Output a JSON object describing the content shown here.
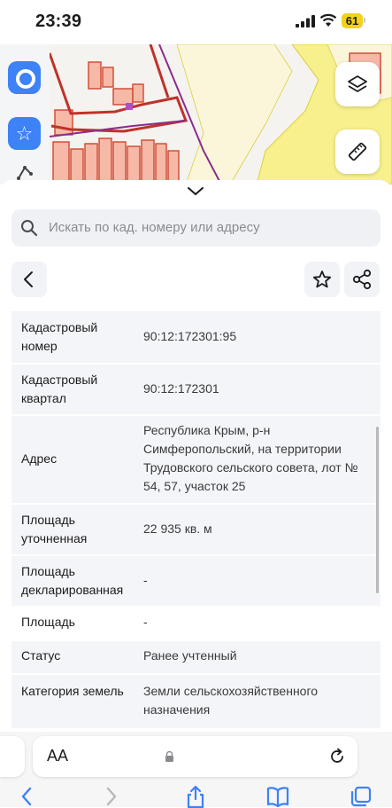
{
  "status_bar": {
    "time": "23:39",
    "battery": "61"
  },
  "sheet": {
    "search_placeholder": "Искать по кад. номеру или адресу",
    "rows": [
      {
        "key": "Кадастровый номер",
        "value": "90:12:172301:95"
      },
      {
        "key": "Кадастровый квартал",
        "value": "90:12:172301"
      },
      {
        "key": "Адрес",
        "value": "Республика Крым, р-н Симферопольский, на территории Трудовского сельского совета, лот № 54, 57, участок 25"
      },
      {
        "key": "Площадь уточненная",
        "value": "22 935 кв. м"
      },
      {
        "key": "Площадь декларированная",
        "value": "-"
      },
      {
        "key": "Площадь",
        "value": "-"
      },
      {
        "key": "Статус",
        "value": "Ранее учтенный"
      },
      {
        "key": "Категория земель",
        "value": "Земли сельскохозяйственного назначения"
      }
    ]
  },
  "safari": {
    "aa_label": "AA"
  },
  "colors": {
    "accent": "#3d82f6",
    "parcel_fill": "#f5b6a5",
    "parcel_border": "#d2452f",
    "boundary": "#8b2c8b",
    "field_yellow": "#f6f08a"
  }
}
